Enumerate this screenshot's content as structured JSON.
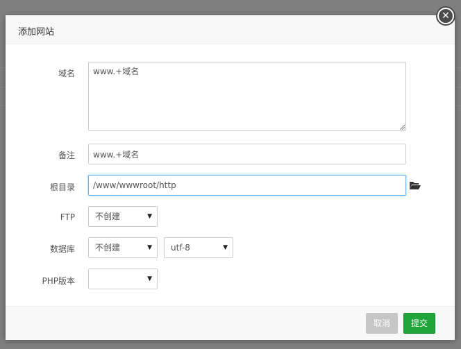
{
  "dialog": {
    "title": "添加网站",
    "close_icon": "close-icon"
  },
  "form": {
    "domain": {
      "label": "域名",
      "value": "www.+域名"
    },
    "remark": {
      "label": "备注",
      "value": "www.+域名"
    },
    "root": {
      "label": "根目录",
      "value": "/www/wwwroot/http",
      "icon": "folder-open-icon"
    },
    "ftp": {
      "label": "FTP",
      "selected": "不创建"
    },
    "database": {
      "label": "数据库",
      "selected": "不创建",
      "charset": "utf-8"
    },
    "php": {
      "label": "PHP版本",
      "selected": ""
    }
  },
  "footer": {
    "cancel_label": "取消",
    "submit_label": "提交"
  },
  "colors": {
    "submit": "#20a53a",
    "cancel": "#c6c6c6",
    "focus_border": "#66afe9"
  }
}
